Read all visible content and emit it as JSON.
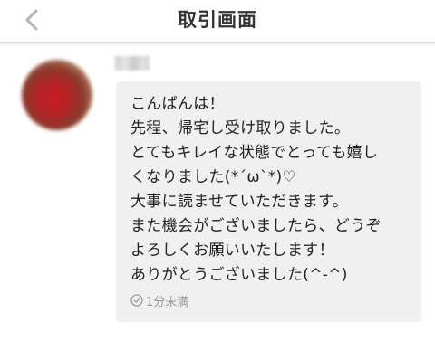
{
  "header": {
    "title": "取引画面",
    "back_icon": "chevron-left-icon"
  },
  "message": {
    "avatar_icon": "blurred-avatar",
    "sender_name_blurred": true,
    "lines": [
      "こんばんは！",
      "先程、帰宅し受け取りました。",
      "とてもキレイな状態でとっても嬉し",
      "くなりました(*´ω`*)♡",
      "大事に読ませていただきます。",
      "また機会がございましたら、どうぞ",
      "よろしくお願いいたします！",
      "ありがとうございました(^-^)"
    ],
    "timestamp": "1分未満",
    "timestamp_icon": "clock-icon"
  }
}
